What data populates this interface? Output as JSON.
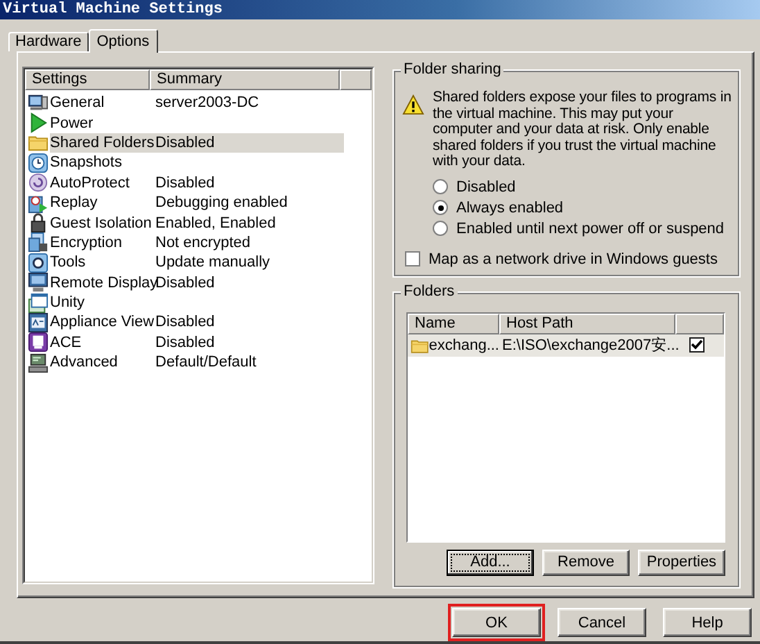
{
  "window": {
    "title": "Virtual Machine Settings"
  },
  "tabs": [
    {
      "label": "Hardware",
      "selected": false
    },
    {
      "label": "Options",
      "selected": true
    }
  ],
  "settings": {
    "columns": [
      "Settings",
      "Summary"
    ],
    "items": [
      {
        "name": "General",
        "summary": "server2003-DC",
        "selected": false
      },
      {
        "name": "Power",
        "selected": false
      },
      {
        "name": "Shared Folders",
        "summary": "Disabled",
        "selected": true
      },
      {
        "name": "Snapshots",
        "selected": false
      },
      {
        "name": "AutoProtect",
        "summary": "Disabled",
        "selected": false
      },
      {
        "name": "Replay",
        "summary": "Debugging enabled",
        "selected": false
      },
      {
        "name": "Guest Isolation",
        "summary": "Enabled, Enabled",
        "selected": false
      },
      {
        "name": "Encryption",
        "summary": "Not encrypted",
        "selected": false
      },
      {
        "name": "Tools",
        "summary": "Update manually",
        "selected": false
      },
      {
        "name": "Remote Display",
        "summary": "Disabled",
        "selected": false
      },
      {
        "name": "Unity",
        "selected": false
      },
      {
        "name": "Appliance View",
        "summary": "Disabled",
        "selected": false
      },
      {
        "name": "ACE",
        "summary": "Disabled",
        "selected": false
      },
      {
        "name": "Advanced",
        "summary": "Default/Default",
        "selected": false
      }
    ]
  },
  "folder_sharing": {
    "title": "Folder sharing",
    "warning": "Shared folders expose your files to programs in the virtual machine. This may put your computer and your data at risk. Only enable shared folders if you trust the virtual machine with your data.",
    "options": [
      {
        "label": "Disabled",
        "selected": false
      },
      {
        "label": "Always enabled",
        "selected": true
      },
      {
        "label": "Enabled until next power off or suspend",
        "selected": false
      }
    ],
    "map_drive": {
      "label": "Map as a network drive in Windows guests",
      "checked": false
    }
  },
  "folders": {
    "title": "Folders",
    "columns": [
      "Name",
      "Host Path"
    ],
    "rows": [
      {
        "name": "exchang...",
        "host_path": "E:\\ISO\\exchange2007安...",
        "enabled": true,
        "selected": true
      }
    ],
    "buttons": [
      "Add...",
      "Remove",
      "Properties"
    ]
  },
  "buttons": [
    {
      "label": "OK",
      "highlighted": true
    },
    {
      "label": "Cancel",
      "highlighted": false
    },
    {
      "label": "Help",
      "highlighted": false
    }
  ]
}
